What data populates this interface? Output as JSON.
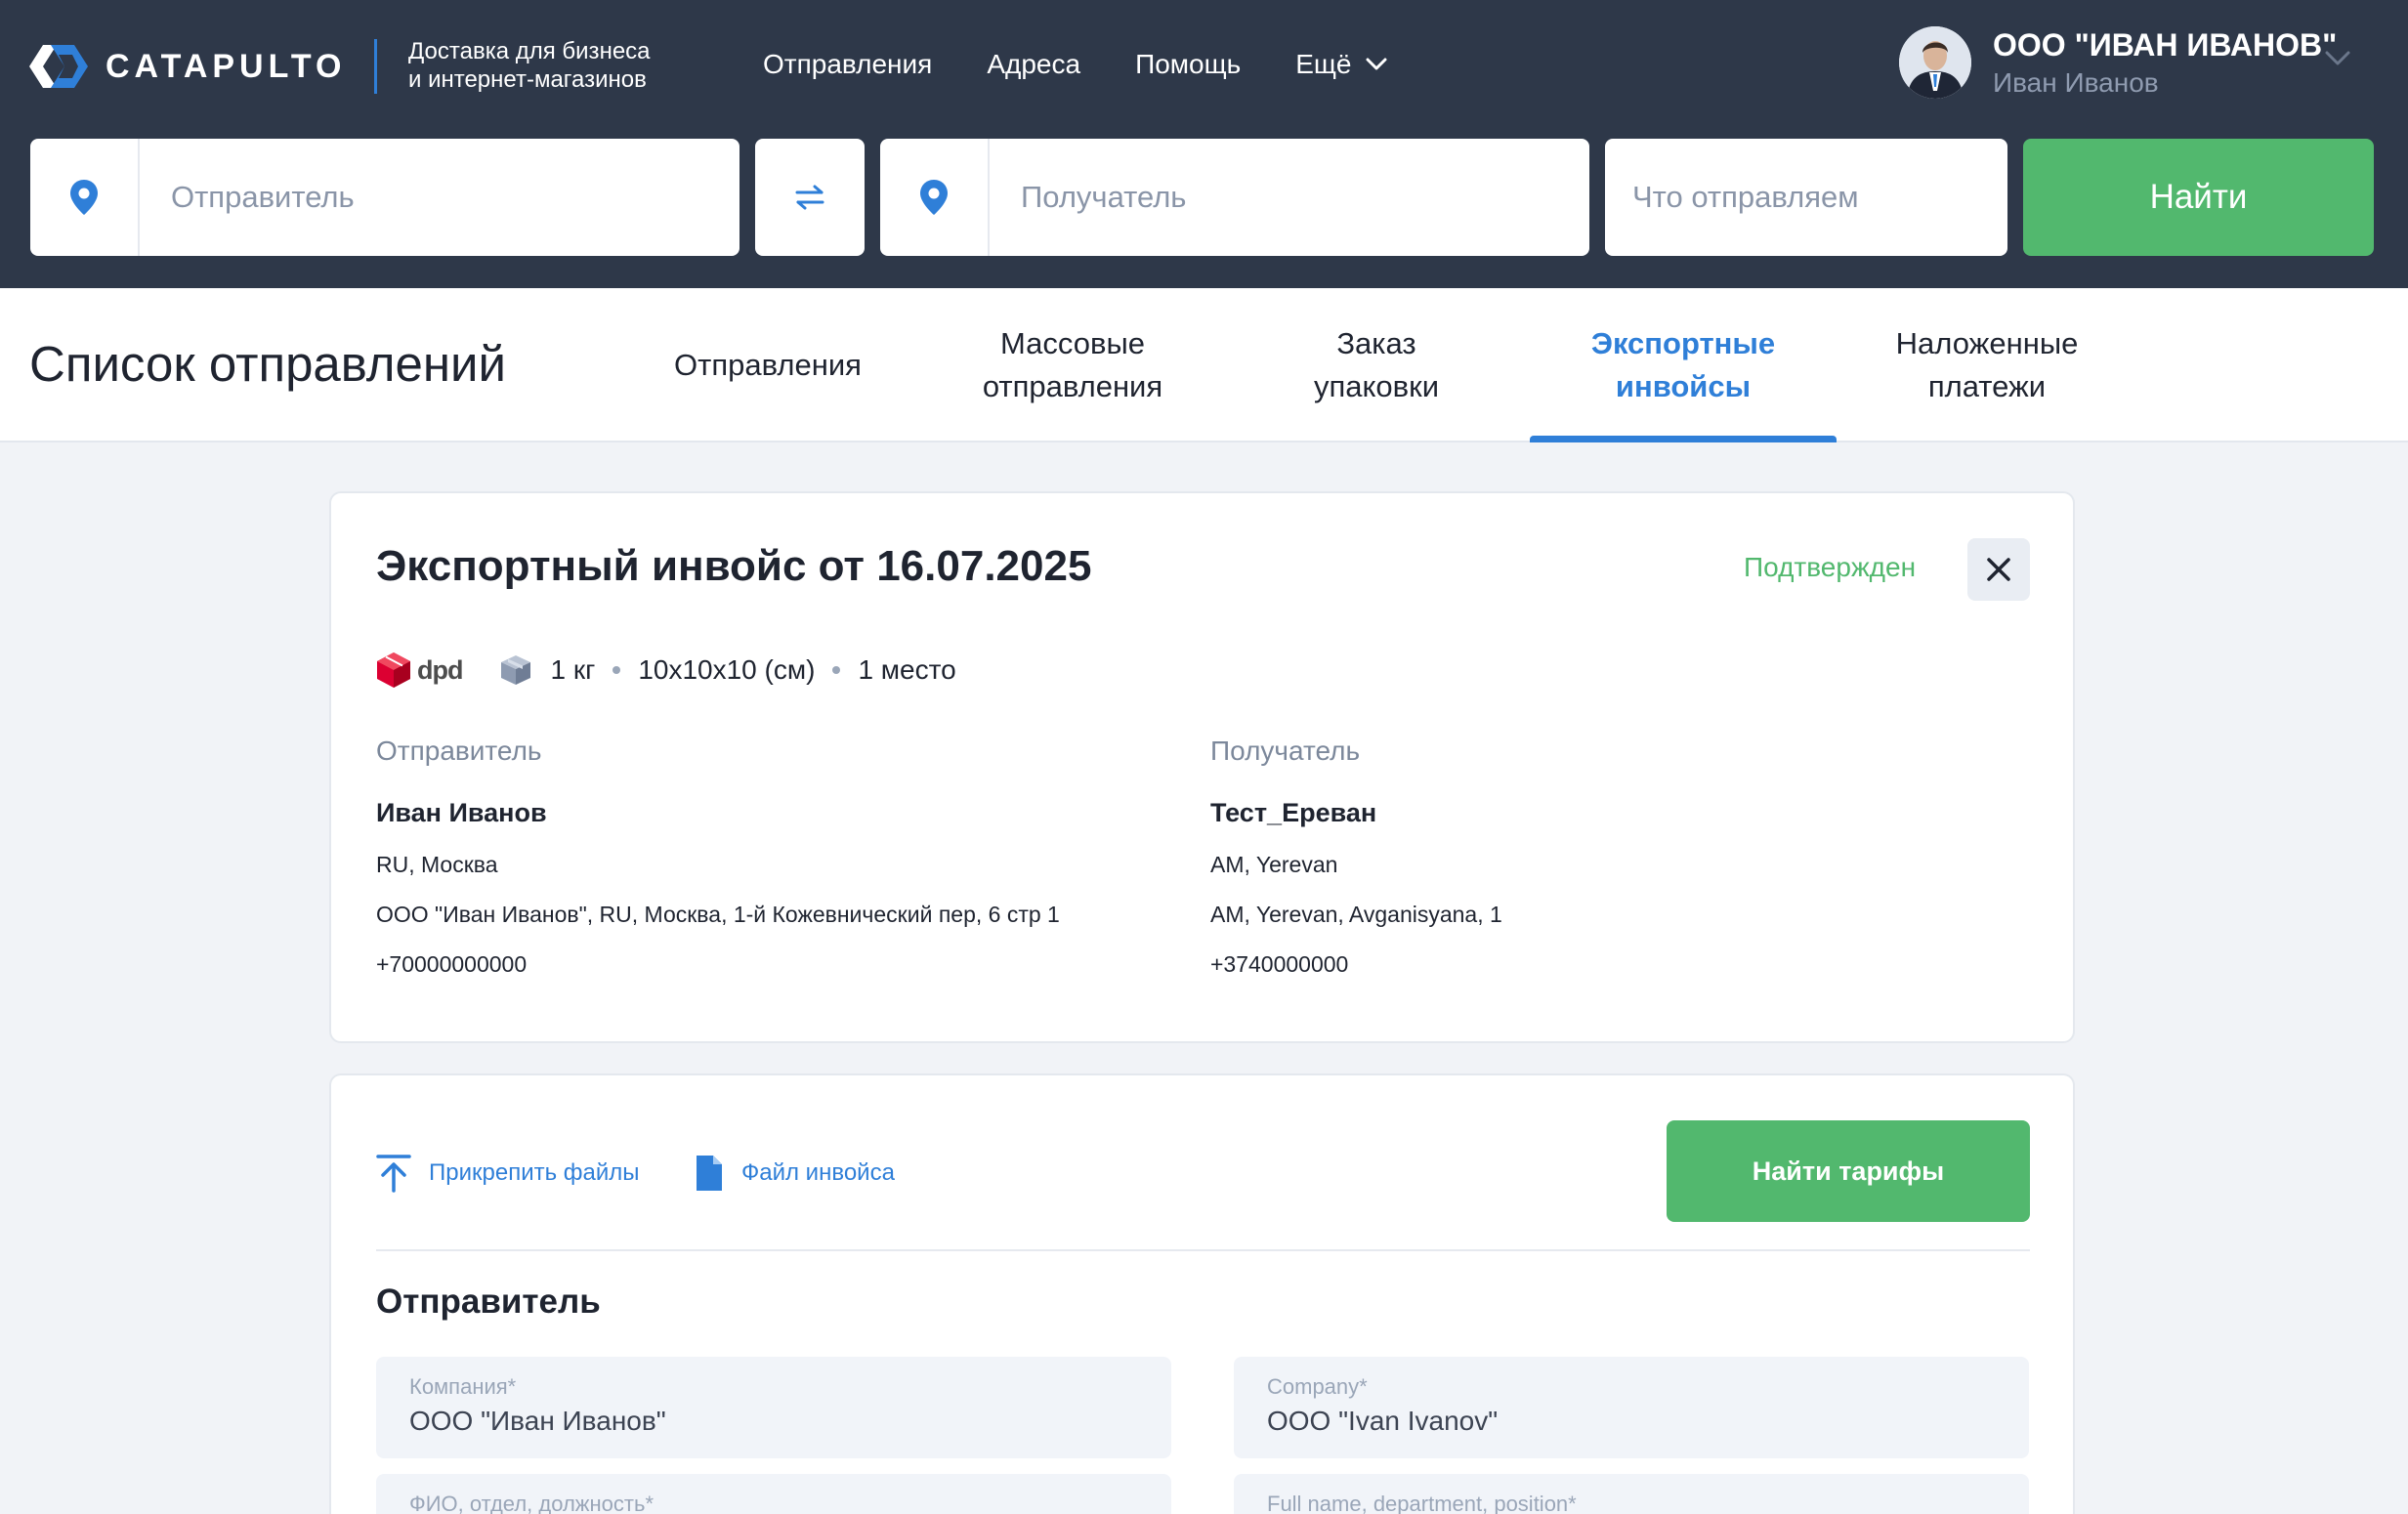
{
  "header": {
    "logo_text": "CATAPULTO",
    "tagline_line1": "Доставка для бизнеса",
    "tagline_line2": "и интернет-магазинов",
    "nav": [
      "Отправления",
      "Адреса",
      "Помощь"
    ],
    "more_label": "Ещё",
    "account_company": "ООО \"ИВАН ИВАНОВ\"",
    "account_user": "Иван Иванов"
  },
  "search": {
    "sender_placeholder": "Отправитель",
    "receiver_placeholder": "Получатель",
    "what_placeholder": "Что отправляем",
    "find_label": "Найти"
  },
  "subnav": {
    "page_title": "Список отправлений",
    "tabs": [
      {
        "line1": "Отправления",
        "line2": ""
      },
      {
        "line1": "Массовые",
        "line2": "отправления"
      },
      {
        "line1": "Заказ",
        "line2": "упаковки"
      },
      {
        "line1": "Экспортные",
        "line2": "инвойсы"
      },
      {
        "line1": "Наложенные",
        "line2": "платежи"
      }
    ],
    "active_tab": "Экспортные инвойсы"
  },
  "invoice": {
    "title": "Экспортный инвойс от 16.07.2025",
    "status": "Подтвержден",
    "carrier": "dpd",
    "weight": "1 кг",
    "dimensions": "10x10x10 (см)",
    "places": "1 место",
    "sender": {
      "label": "Отправитель",
      "name": "Иван Иванов",
      "location": "RU, Москва",
      "address": "ООО \"Иван Иванов\", RU, Москва, 1-й Кожевнический пер, 6 стр 1",
      "phone": "+70000000000"
    },
    "receiver": {
      "label": "Получатель",
      "name": "Тест_Ереван",
      "location": "AM, Yerevan",
      "address": "AM, Yerevan, Avganisyana, 1",
      "phone": "+3740000000"
    }
  },
  "form": {
    "attach_label": "Прикрепить файлы",
    "invoice_file_label": "Файл инвойса",
    "find_tariffs_label": "Найти тарифы",
    "section_title": "Отправитель",
    "fields": {
      "company_ru": {
        "label": "Компания*",
        "value": "ООО \"Иван Иванов\""
      },
      "company_en": {
        "label": "Company*",
        "value": "ООО \"Ivan Ivanov\""
      },
      "person_ru": {
        "label": "ФИО, отдел, должность*",
        "value": ""
      },
      "person_en": {
        "label": "Full name, department, position*",
        "value": ""
      }
    }
  },
  "colors": {
    "header_bg": "#2e3849",
    "accent_blue": "#2f7fd8",
    "accent_green": "#52b86e",
    "page_bg": "#f1f3f7"
  },
  "icons": [
    "logo-mark-icon",
    "location-pin-icon",
    "swap-arrows-icon",
    "chevron-down-icon",
    "close-icon",
    "dpd-cube-icon",
    "package-box-icon",
    "upload-icon",
    "document-icon"
  ]
}
